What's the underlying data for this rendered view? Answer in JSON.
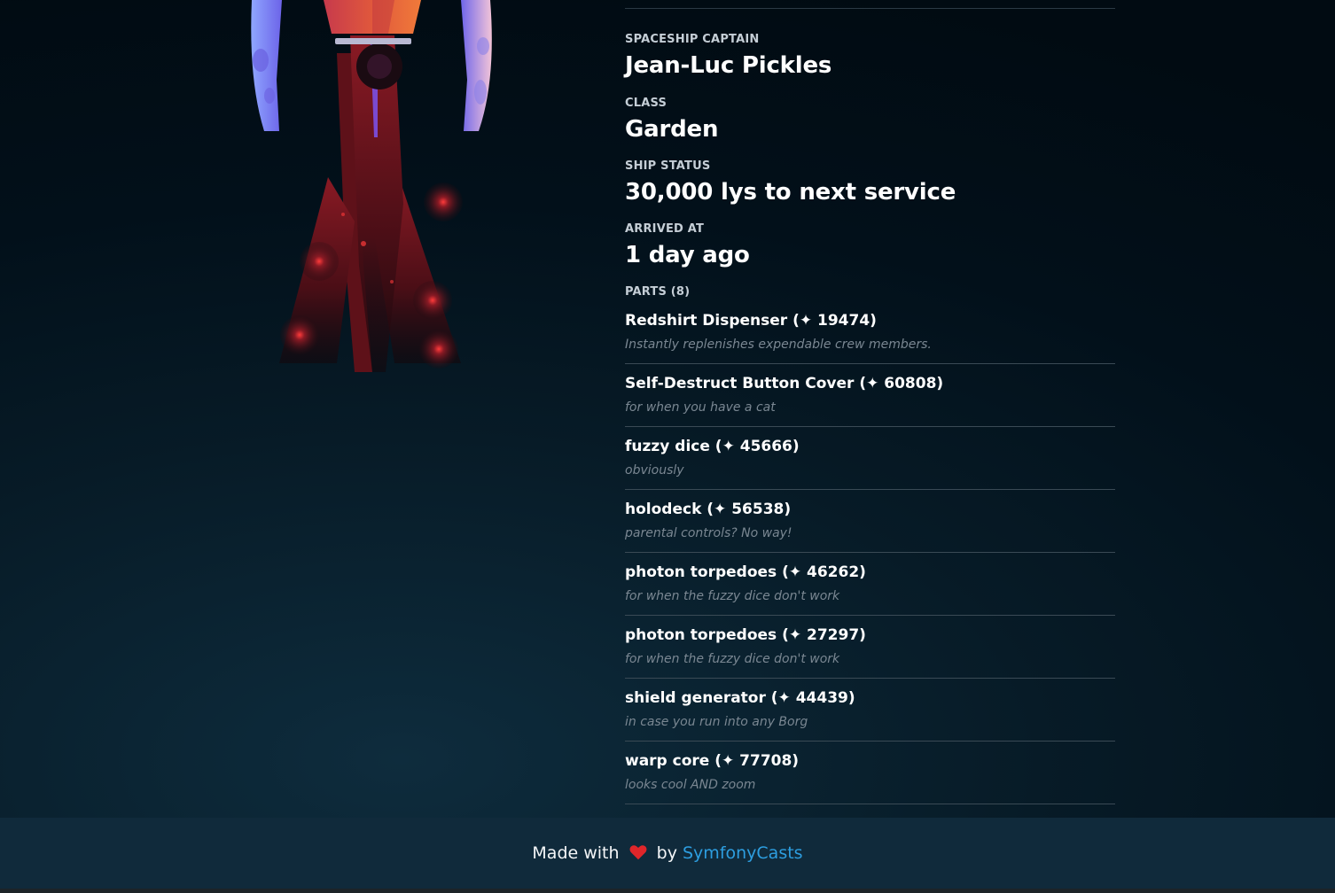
{
  "ship": {
    "captain_label": "SPACESHIP CAPTAIN",
    "captain": "Jean-Luc Pickles",
    "class_label": "CLASS",
    "class": "Garden",
    "status_label": "SHIP STATUS",
    "status": "30,000 lys to next service",
    "arrived_label": "ARRIVED AT",
    "arrived": "1 day ago"
  },
  "parts": {
    "heading": "PARTS (8)",
    "items": [
      {
        "title": "Redshirt Dispenser (✦ 19474)",
        "description": "Instantly replenishes expendable crew members."
      },
      {
        "title": "Self-Destruct Button Cover (✦ 60808)",
        "description": "for when you have a cat"
      },
      {
        "title": "fuzzy dice (✦ 45666)",
        "description": "obviously"
      },
      {
        "title": "holodeck (✦ 56538)",
        "description": "parental controls? No way!"
      },
      {
        "title": "photon torpedoes (✦ 46262)",
        "description": "for when the fuzzy dice don't work"
      },
      {
        "title": "photon torpedoes (✦ 27297)",
        "description": "for when the fuzzy dice don't work"
      },
      {
        "title": "shield generator (✦ 44439)",
        "description": "in case you run into any Borg"
      },
      {
        "title": "warp core (✦ 77708)",
        "description": "looks cool AND zoom"
      }
    ]
  },
  "footer": {
    "made_with": "Made with",
    "by": "by",
    "link": "SymfonyCasts"
  },
  "colors": {
    "link": "#2d9ee0",
    "heart": "#e0262a",
    "background": "#02101a"
  },
  "icons": {
    "heart": "heart-icon",
    "ship": "spaceship-illustration"
  }
}
